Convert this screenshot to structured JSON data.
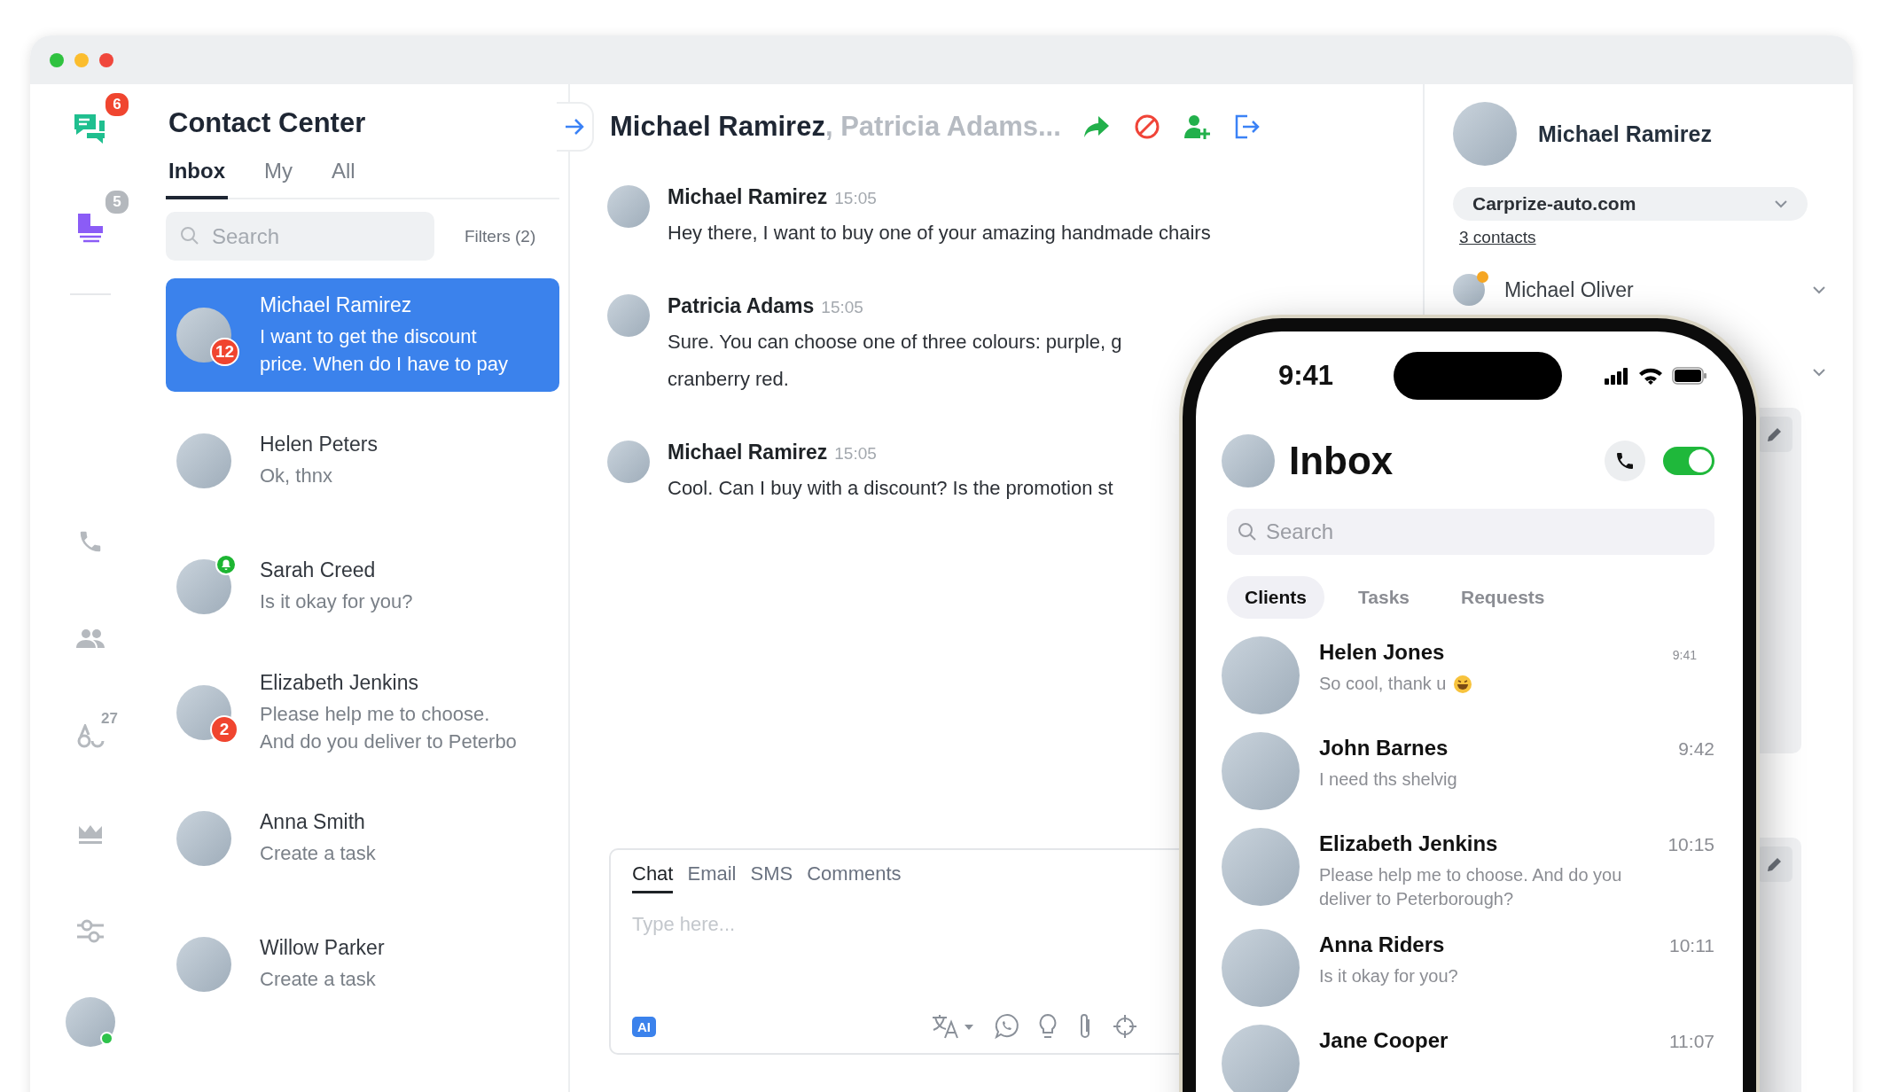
{
  "window": {
    "buttons": [
      {
        "color": "#2fc23f"
      },
      {
        "color": "#fbbd2e"
      },
      {
        "color": "#f0473c"
      }
    ]
  },
  "rail": {
    "items": [
      {
        "kind": "chats",
        "badge": "6",
        "color": "#f0452f"
      },
      {
        "kind": "tasks",
        "badge": "5",
        "color": "#b4b8bd"
      },
      {
        "kind": "divider"
      },
      {
        "kind": "phone"
      },
      {
        "kind": "people"
      },
      {
        "kind": "rings",
        "count": "27"
      },
      {
        "kind": "crown"
      },
      {
        "kind": "sliders"
      }
    ],
    "user": {
      "online": true
    }
  },
  "contacts": {
    "title": "Contact Center",
    "tabs": [
      {
        "label": "Inbox",
        "selected": true
      },
      {
        "label": "My",
        "selected": false
      },
      {
        "label": "All",
        "selected": false
      }
    ],
    "search": {
      "placeholder": "Search"
    },
    "filters": "Filters (2)",
    "items": [
      {
        "name": "Michael Ramirez",
        "preview_lines": [
          "I want to get the discount",
          "price. When do I have to pay"
        ],
        "selected": true,
        "badge": {
          "kind": "count",
          "text": "12"
        }
      },
      {
        "name": "Helen Peters",
        "preview_lines": [
          "Ok, thnx"
        ],
        "selected": false
      },
      {
        "name": "Sarah Creed",
        "preview_lines": [
          "Is it okay for you?"
        ],
        "selected": false,
        "badge": {
          "kind": "bell"
        }
      },
      {
        "name": "Elizabeth Jenkins",
        "preview_lines": [
          "Please help me to choose.",
          "And do you deliver to Peterbo"
        ],
        "selected": false,
        "badge": {
          "kind": "count",
          "text": "2"
        }
      },
      {
        "name": "Anna Smith",
        "preview_lines": [
          "Create a task"
        ],
        "selected": false
      },
      {
        "name": "Willow Parker",
        "preview_lines": [
          "Create a task"
        ],
        "selected": false
      }
    ]
  },
  "chat": {
    "title": "Michael Ramirez",
    "others": ", Patricia Adams...",
    "actions": [
      {
        "kind": "forward"
      },
      {
        "kind": "block"
      },
      {
        "kind": "add-user"
      },
      {
        "kind": "exit"
      }
    ],
    "messages": [
      {
        "author": "Michael Ramirez",
        "time": "15:05",
        "lines": [
          "Hey there, I want to buy one of your amazing handmade chairs"
        ]
      },
      {
        "author": "Patricia Adams",
        "time": "15:05",
        "lines": [
          "Sure. You can choose one of three colours: purple, g",
          "cranberry red."
        ]
      },
      {
        "author": "Michael Ramirez",
        "time": "15:05",
        "lines": [
          "Cool. Can I buy with a discount? Is the promotion st"
        ]
      }
    ],
    "composer": {
      "tabs": [
        {
          "label": "Chat",
          "selected": true
        },
        {
          "label": "Email",
          "selected": false
        },
        {
          "label": "SMS",
          "selected": false
        },
        {
          "label": "Comments",
          "selected": false
        }
      ],
      "placeholder": "Type here...",
      "ai_label": "AI",
      "tools": [
        {
          "kind": "translate"
        },
        {
          "kind": "whatsapp"
        },
        {
          "kind": "bulb"
        },
        {
          "kind": "clip"
        },
        {
          "kind": "target"
        }
      ]
    }
  },
  "profile": {
    "name": "Michael Ramirez",
    "company": "Carprize-auto.com",
    "contacts_link": "3 contacts",
    "people": [
      {
        "name": "Michael Oliver",
        "color": "#f5a623"
      }
    ]
  },
  "phone": {
    "time": "9:41",
    "title": "Inbox",
    "toggle": {
      "on": true
    },
    "search": {
      "placeholder": "Search"
    },
    "tabs": [
      {
        "label": "Clients",
        "selected": true
      },
      {
        "label": "Tasks",
        "selected": false
      },
      {
        "label": "Requests",
        "selected": false
      }
    ],
    "chats": [
      {
        "name": "Helen Jones",
        "preview": "So cool, thank u",
        "emoji": true,
        "time": "9:41"
      },
      {
        "name": "John Barnes",
        "preview": "I need ths shelvig",
        "emoji": false,
        "time": "9:42"
      },
      {
        "name": "Elizabeth Jenkins",
        "preview": "Please help me to choose. And do you deliver to Peterborough?",
        "emoji": false,
        "time": "10:15"
      },
      {
        "name": "Anna Riders",
        "preview": "Is it okay for you?",
        "emoji": false,
        "time": "10:11"
      },
      {
        "name": "Jane Cooper",
        "time": "11:07"
      }
    ]
  }
}
